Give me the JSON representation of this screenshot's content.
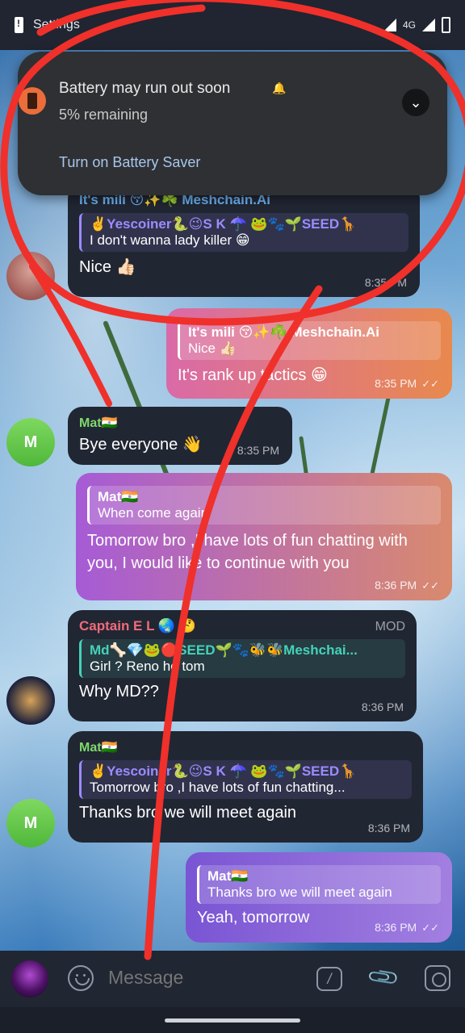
{
  "status_bar": {
    "app": "Settings",
    "network": "4G"
  },
  "notification": {
    "title": "Battery may run out soon",
    "subtitle": "5% remaining",
    "action": "Turn on Battery Saver"
  },
  "messages": [
    {
      "name": "It's mili 😚✨☘️ Meshchain.Ai",
      "reply_name": "✌️Yescoiner🐍😉S K ☂️ 🐸🐾🌱SEED🦒",
      "reply_text": "I don't wanna lady killer 😁",
      "text": "Nice 👍🏻",
      "time": "8:35 PM"
    },
    {
      "reply_name": "It's mili 😚✨☘️ Meshchain.Ai",
      "reply_text": "Nice 👍🏻",
      "text": "It's  rank up tactics 😁",
      "time": "8:35 PM"
    },
    {
      "name": "Mat🇮🇳",
      "text": "Bye everyone 👋",
      "time": "8:35 PM"
    },
    {
      "reply_name": "Mat🇮🇳",
      "reply_text": "When come again",
      "text": "Tomorrow bro ,I have lots of fun chatting with you, I would like to continue with you",
      "time": "8:36 PM"
    },
    {
      "name": "Captain E L 🌏 🤔",
      "badge": "MOD",
      "reply_name": "Md🦴💎🐸🔴SEED🌱🐾🐝🐝Meshchai...",
      "reply_text": "Girl ?  Reno ho tom",
      "text": "Why MD??",
      "time": "8:36 PM"
    },
    {
      "name": "Mat🇮🇳",
      "reply_name": "✌️Yescoiner🐍😉S K ☂️ 🐸🐾🌱SEED🦒",
      "reply_text": "Tomorrow bro ,I have lots of fun chatting...",
      "text": "Thanks bro we will meet again",
      "time": "8:36 PM"
    },
    {
      "reply_name": "Mat🇮🇳",
      "reply_text": "Thanks bro we will meet again",
      "text": "Yeah, tomorrow",
      "time": "8:36 PM"
    }
  ],
  "avatars": {
    "mat_initial": "M"
  },
  "input": {
    "placeholder": "Message"
  },
  "colors": {
    "incoming_bubble": "#212633",
    "name_blue": "#6ab2f2",
    "name_green": "#7fd86b",
    "name_red": "#f06b7a",
    "reply_purple": "#9b8cff",
    "reply_teal": "#46d2b8",
    "annotation_red": "#f0302a"
  },
  "icons": [
    "emoji-icon",
    "command-icon",
    "attach-icon",
    "camera-icon",
    "battery-alert-icon",
    "expand-icon"
  ]
}
